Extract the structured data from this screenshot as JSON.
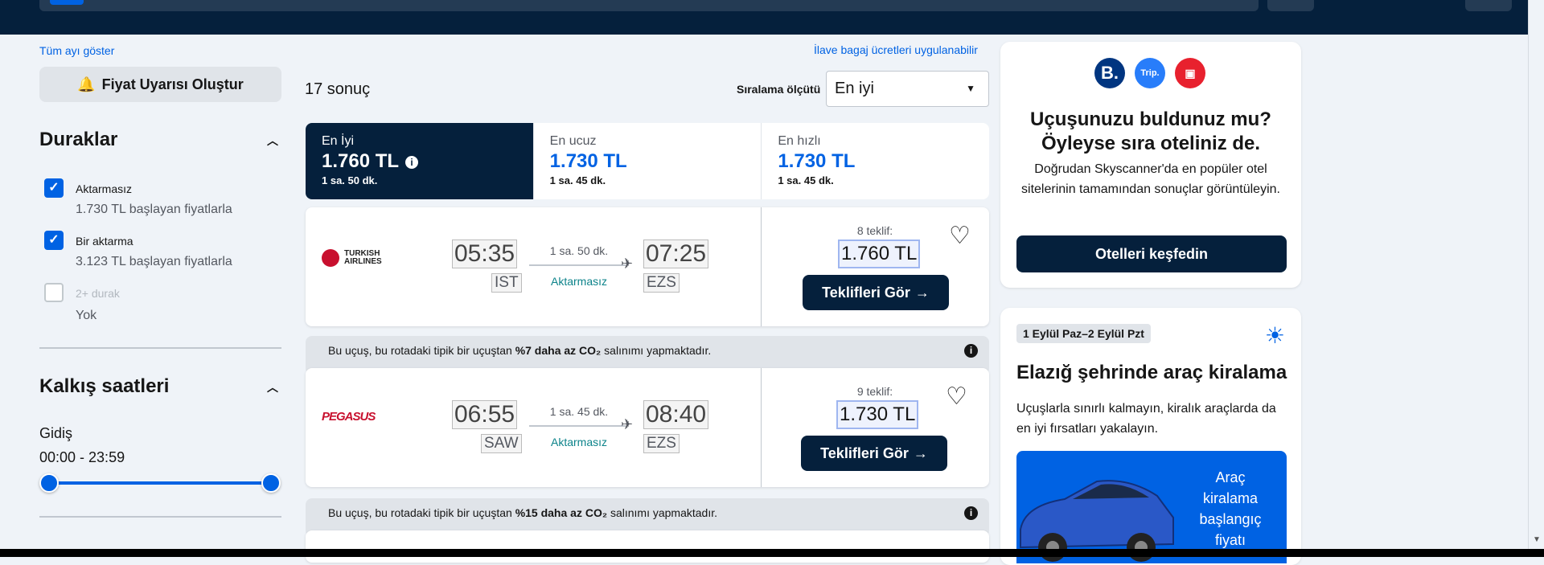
{
  "left": {
    "show_month": "Tüm ayı göster",
    "alert_btn": "Fiyat Uyarısı Oluştur",
    "stops_title": "Duraklar",
    "stops": [
      {
        "label": "Aktarmasız",
        "sub": "1.730 TL başlayan fiyatlarla",
        "checked": true
      },
      {
        "label": "Bir aktarma",
        "sub": "3.123 TL başlayan fiyatlarla",
        "checked": true
      },
      {
        "label": "2+ durak",
        "sub": "Yok",
        "checked": false
      }
    ],
    "times_title": "Kalkış saatleri",
    "outbound": "Gidiş",
    "time_range": "00:00 - 23:59"
  },
  "results": {
    "baggage_note": "İlave bagaj ücretleri uygulanabilir",
    "count": "17 sonuç",
    "sort_label": "Sıralama ölçütü",
    "sort_value": "En iyi",
    "tabs": [
      {
        "title": "En İyi",
        "price": "1.760 TL",
        "duration": "1 sa. 50 dk."
      },
      {
        "title": "En ucuz",
        "price": "1.730 TL",
        "duration": "1 sa. 45 dk."
      },
      {
        "title": "En hızlı",
        "price": "1.730 TL",
        "duration": "1 sa. 45 dk."
      }
    ],
    "flights": [
      {
        "airline": "TURKISH AIRLINES",
        "dep": "05:35",
        "dep_apt": "IST",
        "dur": "1 sa. 50 dk.",
        "stops": "Aktarmasız",
        "arr": "07:25",
        "arr_apt": "EZS",
        "offers": "8 teklif:",
        "price": "1.760 TL",
        "btn": "Teklifleri Gör"
      },
      {
        "airline": "PEGASUS",
        "dep": "06:55",
        "dep_apt": "SAW",
        "dur": "1 sa. 45 dk.",
        "stops": "Aktarmasız",
        "arr": "08:40",
        "arr_apt": "EZS",
        "offers": "9 teklif:",
        "price": "1.730 TL",
        "btn": "Teklifleri Gör"
      }
    ],
    "eco_notes": [
      {
        "pre": "Bu uçuş, bu rotadaki tipik bir uçuştan ",
        "bold": "%7 daha az CO₂",
        "post": " salınımı yapmaktadır."
      },
      {
        "pre": "Bu uçuş, bu rotadaki tipik bir uçuştan ",
        "bold": "%15 daha az CO₂",
        "post": " salınımı yapmaktadır."
      }
    ]
  },
  "hotel_panel": {
    "logos": [
      "B.",
      "Trip.",
      "▣"
    ],
    "title": "Uçuşunuzu buldunuz mu? Öyleyse sıra oteliniz de.",
    "text": "Doğrudan Skyscanner'da en popüler otel sitelerinin tamamından sonuçlar görüntüleyin.",
    "btn": "Otelleri keşfedin"
  },
  "car_panel": {
    "dates": "1 Eylül Paz–2 Eylül Pzt",
    "title": "Elazığ şehrinde araç kiralama",
    "text": "Uçuşlarla sınırlı kalmayın, kiralık araçlarda da en iyi fırsatları yakalayın.",
    "box_text": "Araç kiralama başlangıç fiyatı"
  },
  "colors": {
    "navy": "#05203c",
    "blue": "#0062e3",
    "teal": "#0c838a"
  }
}
